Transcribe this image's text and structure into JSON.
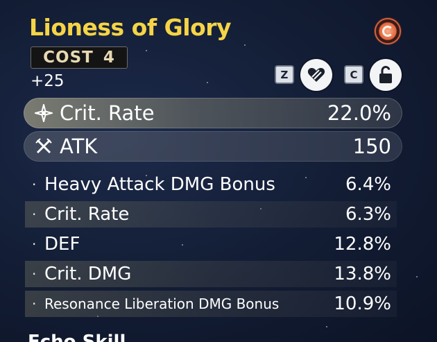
{
  "echo": {
    "name": "Lioness of Glory",
    "cost_label": "COST",
    "cost_value": "4",
    "level": "+25",
    "sonata_icon": "sonata-emblem-icon"
  },
  "controls": {
    "lock_key": "Z",
    "lock_icon": "discard-heart-icon",
    "unlock_key": "C",
    "unlock_icon": "padlock-open-icon"
  },
  "main_stats": [
    {
      "icon": "crit-star-icon",
      "label": "Crit. Rate",
      "value": "22.0%"
    },
    {
      "icon": "crossed-swords-icon",
      "label": "ATK",
      "value": "150"
    }
  ],
  "sub_stats": [
    {
      "label": "Heavy Attack DMG Bonus",
      "value": "6.4%"
    },
    {
      "label": "Crit. Rate",
      "value": "6.3%"
    },
    {
      "label": "DEF",
      "value": "12.8%"
    },
    {
      "label": "Crit. DMG",
      "value": "13.8%"
    },
    {
      "label": "Resonance Liberation DMG Bonus",
      "value": "10.9%"
    }
  ],
  "footer": {
    "label": "Echo Skill"
  },
  "colors": {
    "title": "#f5d447",
    "background": "#121c33"
  }
}
